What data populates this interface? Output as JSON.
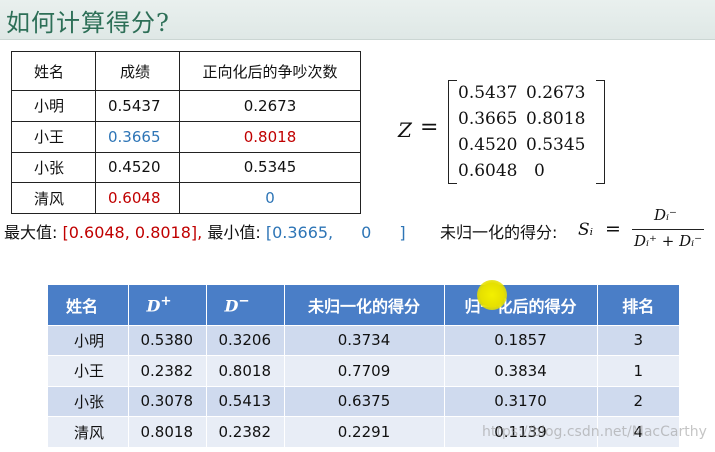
{
  "title": "如何计算得分?",
  "table1": {
    "headers": [
      "姓名",
      "成绩",
      "正向化后的争吵次数"
    ],
    "rows": [
      {
        "name": "小明",
        "score": "0.5437",
        "fights": "0.2673"
      },
      {
        "name": "小王",
        "score": "0.3665",
        "fights": "0.8018"
      },
      {
        "name": "小张",
        "score": "0.4520",
        "fights": "0.5345"
      },
      {
        "name": "清风",
        "score": "0.6048",
        "fights": "0"
      }
    ]
  },
  "matrix": {
    "label": "Z",
    "eq": "=",
    "rows": [
      [
        "0.5437",
        "0.2673"
      ],
      [
        "0.3665",
        "0.8018"
      ],
      [
        "0.4520",
        "0.5345"
      ],
      [
        "0.6048",
        "0"
      ]
    ]
  },
  "extremes": {
    "max_label": "最大值:",
    "max_open": "[",
    "max_a": "0.6048,",
    "max_b": "0.8018",
    "max_close": "],",
    "min_label": " 最小值:",
    "min_open": "[",
    "min_a": "0.3665,",
    "min_b": "0",
    "min_close": "]"
  },
  "formula": {
    "label": "未归一化的得分:",
    "s": "Sᵢ",
    "eq": "=",
    "numerator": "Dᵢ⁻",
    "denominator": "Dᵢ⁺ + Dᵢ⁻"
  },
  "table2": {
    "headers": {
      "name": "姓名",
      "dplus_base": "D",
      "dplus_sup": "+",
      "dminus_base": "D",
      "dminus_sup": "−",
      "raw": "未归一化的得分",
      "norm": "归一化后的得分",
      "rank": "排名"
    },
    "rows": [
      {
        "name": "小明",
        "dplus": "0.5380",
        "dminus": "0.3206",
        "raw": "0.3734",
        "norm": "0.1857",
        "rank": "3"
      },
      {
        "name": "小王",
        "dplus": "0.2382",
        "dminus": "0.8018",
        "raw": "0.7709",
        "norm": "0.3834",
        "rank": "1"
      },
      {
        "name": "小张",
        "dplus": "0.3078",
        "dminus": "0.5413",
        "raw": "0.6375",
        "norm": "0.3170",
        "rank": "2"
      },
      {
        "name": "清风",
        "dplus": "0.8018",
        "dminus": "0.2382",
        "raw": "0.2291",
        "norm": "0.1139",
        "rank": "4"
      }
    ]
  },
  "watermark": "https://blog.csdn.net/MacCarthy",
  "colors": {
    "title": "#2d6f57",
    "header": "#4a7ec7",
    "highlight_blue": "#2e75b6",
    "highlight_red": "#c00000",
    "cursor": "#e6e000"
  }
}
